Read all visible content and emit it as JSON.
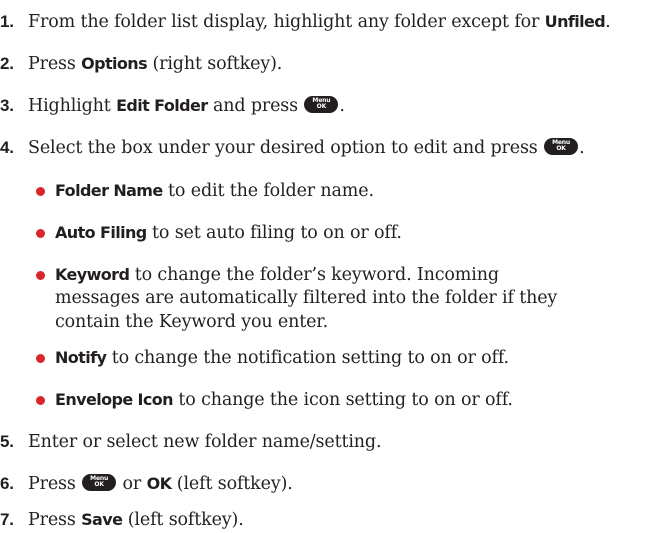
{
  "steps": [
    {
      "num": "1.",
      "t1": "From the folder list display, highlight any folder except for ",
      "b1": "Unfiled",
      "t2": "."
    },
    {
      "num": "2.",
      "t1": "Press ",
      "b1": "Options",
      "t2": " (right softkey)."
    },
    {
      "num": "3.",
      "t1": "Highlight ",
      "b1": "Edit Folder",
      "t2": " and press ",
      "t3": "."
    },
    {
      "num": "4.",
      "t1": "Select the box under your desired option to edit and press ",
      "t2": "."
    },
    {
      "num": "5.",
      "t1": "Enter or select new folder name/setting."
    },
    {
      "num": "6.",
      "t1": "Press ",
      "t2": " or ",
      "b1": "OK",
      "t3": " (left softkey)."
    },
    {
      "num": "7.",
      "t1": "Press ",
      "b1": "Save",
      "t2": " (left softkey)."
    }
  ],
  "bullets": [
    {
      "b": "Folder Name",
      "t": " to edit the folder name."
    },
    {
      "b": "Auto Filing",
      "t": " to set auto filing to on or off."
    },
    {
      "b": "Keyword",
      "t": " to change the folder’s keyword. Incoming",
      "l2": "messages are automatically filtered into the folder if they",
      "l3": "contain the Keyword you enter."
    },
    {
      "b": "Notify",
      "t": " to change the notification setting to on or off."
    },
    {
      "b": "Envelope Icon",
      "t": " to change the icon setting to on or off."
    }
  ],
  "menu_key": {
    "top": "Menu",
    "bottom": "OK",
    "icon": "menu-ok-key-icon"
  },
  "colors": {
    "text": "#231f20",
    "bullet": "#d9252b",
    "key": "#231f20"
  }
}
